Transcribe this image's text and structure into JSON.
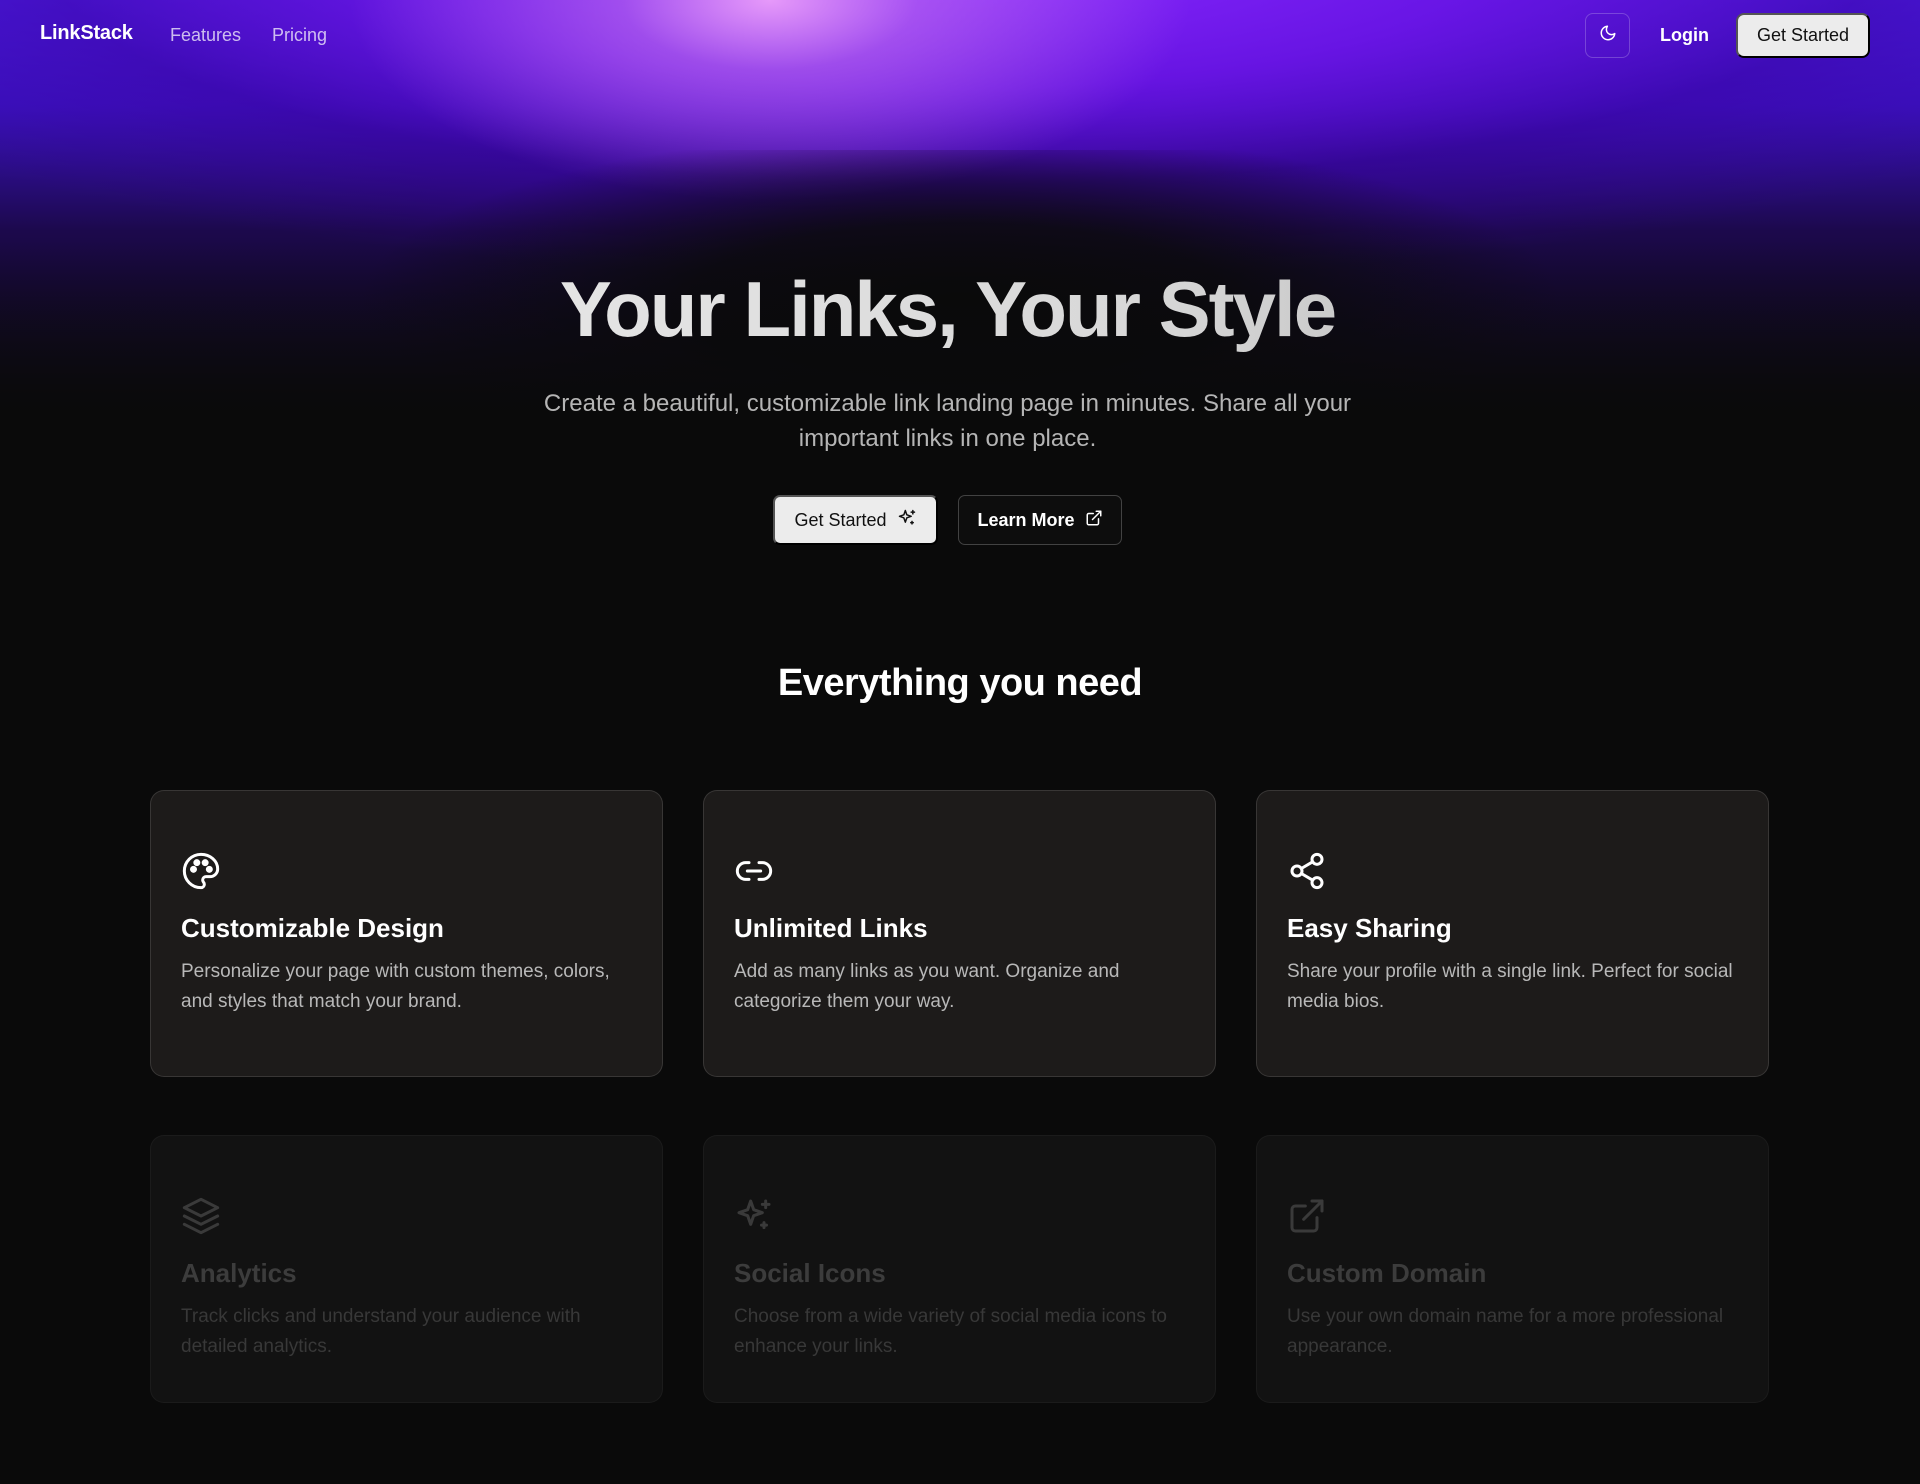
{
  "nav": {
    "logo": "LinkStack",
    "links": [
      "Features",
      "Pricing"
    ],
    "theme_toggle_icon": "moon-icon",
    "login": "Login",
    "cta": "Get Started"
  },
  "hero": {
    "title": "Your Links, Your Style",
    "subtitle": "Create a beautiful, customizable link landing page in minutes. Share all your important links in one place.",
    "primary_button": {
      "label": "Get Started",
      "icon": "sparkles-icon"
    },
    "secondary_button": {
      "label": "Learn More",
      "icon": "external-link-icon"
    }
  },
  "features": {
    "title": "Everything you need",
    "items": [
      {
        "title": "Customizable Design",
        "description": "Personalize your page with custom themes, colors, and styles that match your brand.",
        "icon": "palette-icon"
      },
      {
        "title": "Unlimited Links",
        "description": "Add as many links as you want. Organize and categorize them your way.",
        "icon": "link-icon"
      },
      {
        "title": "Easy Sharing",
        "description": "Share your profile with a single link. Perfect for social media bios.",
        "icon": "share-icon"
      },
      {
        "title": "Analytics",
        "description": "Track clicks and understand your audience with detailed analytics.",
        "icon": "layers-icon"
      },
      {
        "title": "Social Icons",
        "description": "Choose from a wide variety of social media icons to enhance your links.",
        "icon": "sparkles-icon"
      },
      {
        "title": "Custom Domain",
        "description": "Use your own domain name for a more professional appearance.",
        "icon": "external-link-icon"
      }
    ]
  },
  "colors": {
    "background": "#0a0a0a",
    "card": "#1d1b1a",
    "glow_purple": "#7a1cf0",
    "glow_pink": "#eca0fa",
    "button_light": "#ececec"
  }
}
